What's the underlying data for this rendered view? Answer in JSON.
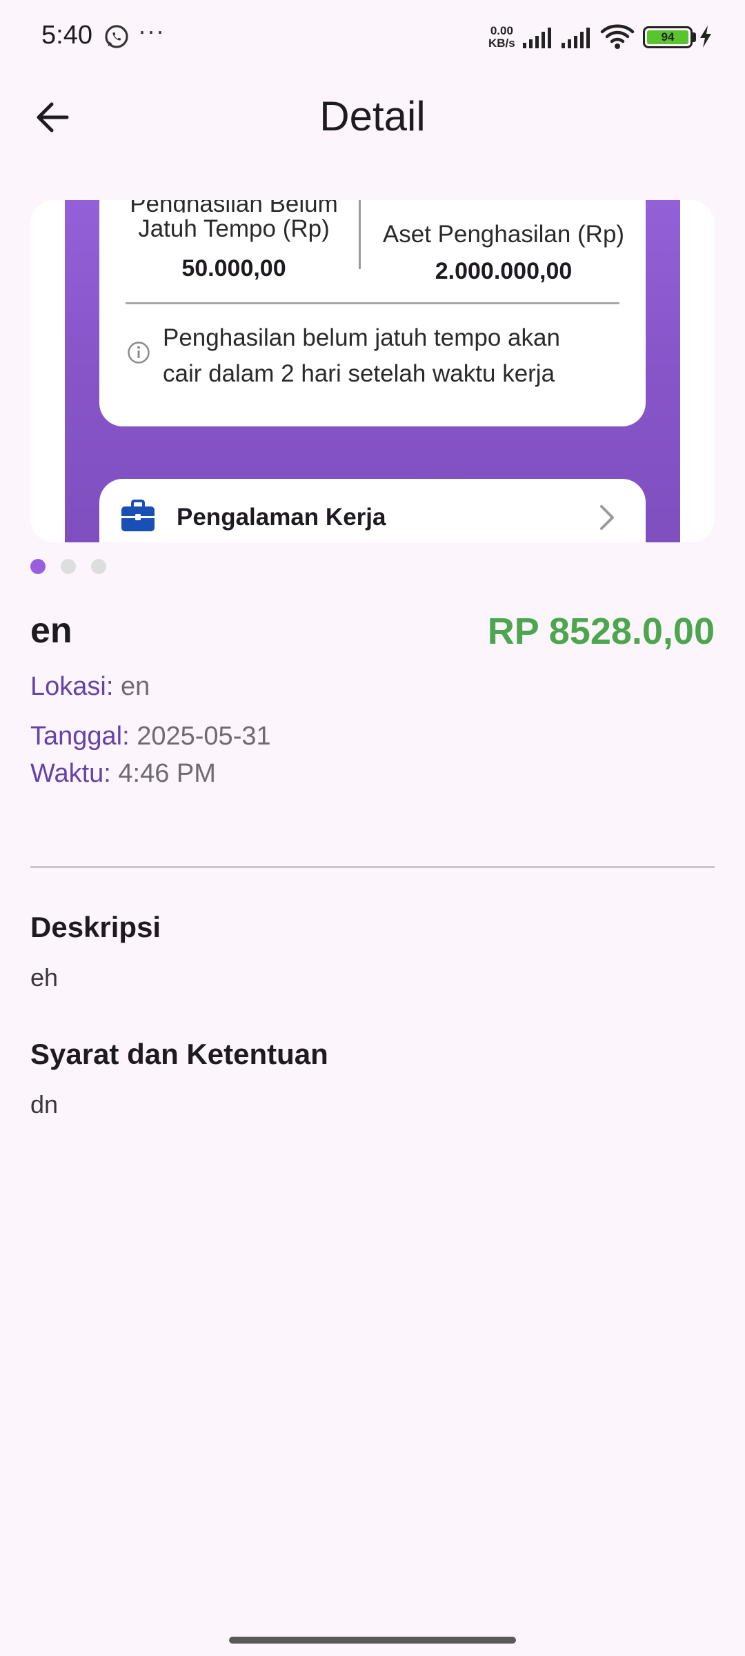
{
  "status_bar": {
    "time": "5:40",
    "more": "···",
    "net_speed_value": "0.00",
    "net_speed_unit": "KB/s",
    "battery_level": "94",
    "icons": [
      "whatsapp-icon",
      "signal-icon",
      "signal-icon",
      "wifi-icon",
      "battery-icon",
      "charging-bolt-icon"
    ]
  },
  "app_bar": {
    "title": "Detail",
    "back_icon": "arrow-left-icon"
  },
  "carousel": {
    "slide_count": 3,
    "active_index": 0,
    "earnings_card": {
      "left_label_top": "Penghasilan Belum",
      "left_label": "Jatuh Tempo (Rp)",
      "left_value": "50.000,00",
      "right_label": "Aset Penghasilan (Rp)",
      "right_value": "2.000.000,00",
      "info_text": "Penghasilan belum jatuh tempo akan cair dalam 2 hari setelah waktu kerja"
    },
    "experience_card": {
      "label": "Pengalaman Kerja",
      "icon": "briefcase-icon"
    },
    "colors": {
      "promo_purple": "#8b58cc",
      "briefcase_blue": "#1a4fb5",
      "active_dot": "#9a5de0"
    }
  },
  "job": {
    "title": "en",
    "price": "RP 8528.0,00",
    "price_color": "#4ca64e",
    "location_label": "Lokasi:",
    "location_value": "en",
    "date_label": "Tanggal:",
    "date_value": "2025-05-31",
    "time_label": "Waktu:",
    "time_value": "4:46 PM"
  },
  "description": {
    "heading": "Deskripsi",
    "text": "eh"
  },
  "terms": {
    "heading": "Syarat dan Ketentuan",
    "text": "dn"
  }
}
